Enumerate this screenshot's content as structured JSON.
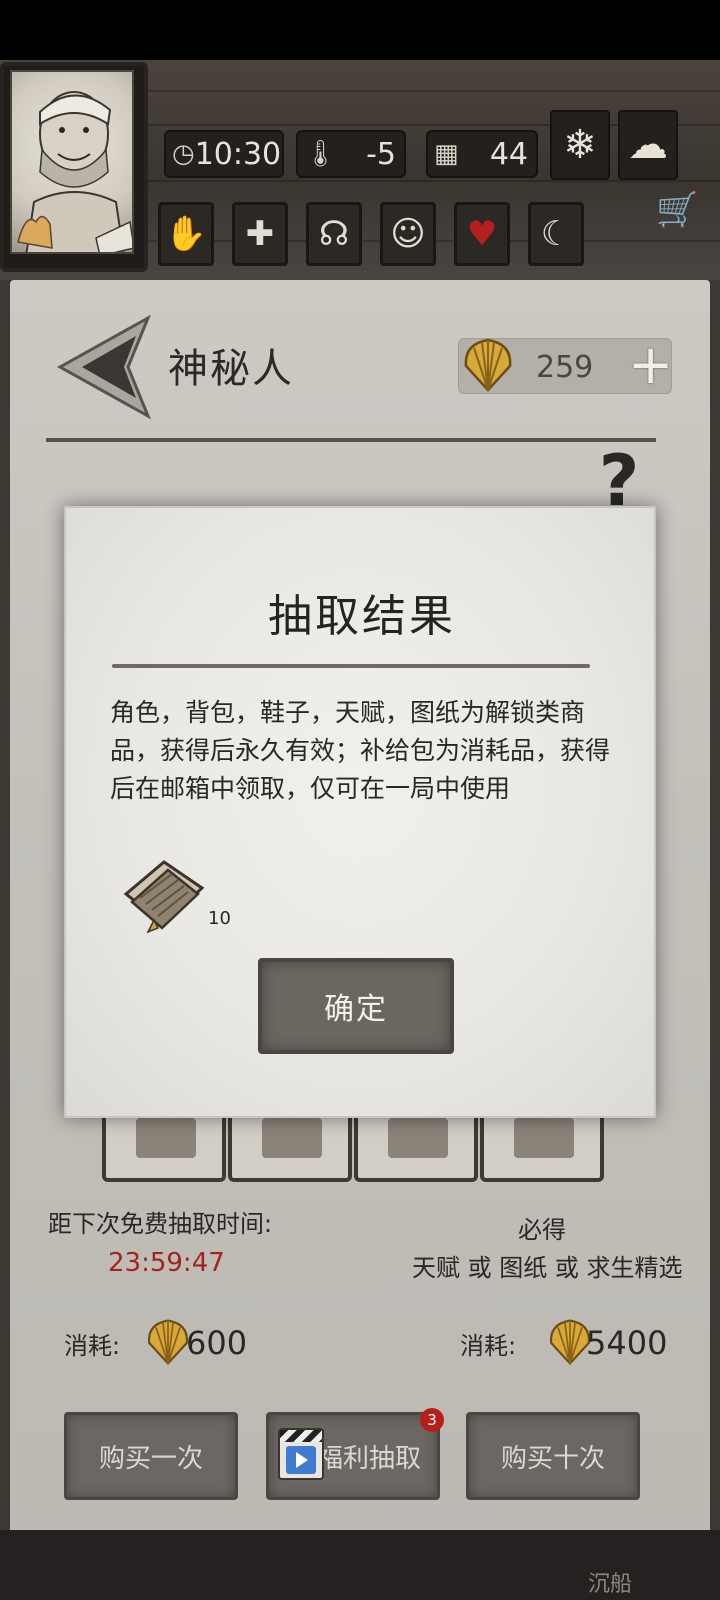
{
  "hud": {
    "time": "10:30",
    "temperature": "-5",
    "day": "44",
    "icons": {
      "clock": "clock-icon",
      "thermometer": "thermometer-icon",
      "calendar": "calendar-icon",
      "weather_snow": "snowflake-icon",
      "weather_cloud": "cloud-icon",
      "cart": "shopping-cart-icon",
      "status": [
        "bandage-hand-icon",
        "health-cross-icon",
        "stomach-icon",
        "mind-head-icon",
        "heart-icon",
        "moon-star-icon"
      ]
    }
  },
  "shop": {
    "title": "神秘人",
    "currency": "259",
    "add_symbol": "+",
    "help_symbol": "?",
    "free_timer_label": "距下次免费抽取时间:",
    "free_timer_value": "23:59:47",
    "guarantee_label": "必得",
    "guarantee_detail": "天赋 或 图纸 或 求生精选",
    "cost_label": "消耗:",
    "single_cost": "600",
    "ten_cost": "5400",
    "buy_once": "购买一次",
    "welfare_draw": "福利抽取",
    "welfare_badge": "3",
    "buy_ten": "购买十次",
    "bottom_hint": "沉船"
  },
  "dialog": {
    "title": "抽取结果",
    "description": "角色，背包，鞋子，天赋，图纸为解锁类商品，获得后永久有效；补给包为消耗品，获得后在邮箱中领取，仅可在一局中使用",
    "reward_count": "10",
    "confirm": "确定"
  },
  "colors": {
    "timer_red": "#a3231f",
    "badge_red": "#b81f1a",
    "shell_gold": "#d8a93a"
  }
}
